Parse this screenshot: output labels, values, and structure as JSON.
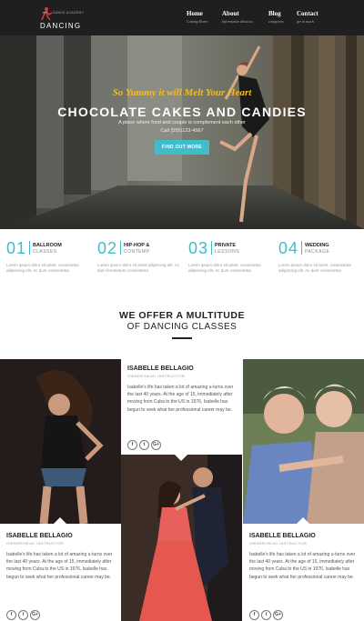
{
  "brand": {
    "name": "DANCING",
    "tagline": "DANCE ACADEMY"
  },
  "nav": [
    {
      "title": "Home",
      "sub": "Coming Home"
    },
    {
      "title": "About",
      "sub": "Information about us"
    },
    {
      "title": "Blog",
      "sub": "categories"
    },
    {
      "title": "Contact",
      "sub": "get in touch"
    }
  ],
  "hero": {
    "script": "So Yummy it will Melt Your Heart",
    "title": "CHOCOLATE CAKES AND CANDIES",
    "subtitle": "A place where food and couple is complement each other",
    "call": "Call (555)123-4567",
    "button": "FIND OUT MORE"
  },
  "features": [
    {
      "num": "01",
      "title": "BALLROOM",
      "sub": "CLASSES",
      "desc": "Lorem ipsum dolor sit amet, consectetur adipiscing elit. Ac dum consectetur."
    },
    {
      "num": "02",
      "title": "HIP-HOP &",
      "sub": "CONTEMP",
      "desc": "Lorem ipsum dolor sit amet adipiscing elit. Ac dum fermentum consectetur."
    },
    {
      "num": "03",
      "title": "PRIVATE",
      "sub": "LESSONS",
      "desc": "Lorem ipsum dolor sit amet, consectetur adipiscing elit. Ac dum consectetur."
    },
    {
      "num": "04",
      "title": "WEDDING",
      "sub": "PACKAGE",
      "desc": "Lorem ipsum dolor sit amet, consectetur adipiscing elit. Ac dum consectetur."
    }
  ],
  "offer": {
    "line1": "WE OFFER A MULTITUDE",
    "line2": "OF DANCING CLASSES"
  },
  "instructors": [
    {
      "name": "ISABELLE BELLAGIO",
      "role": "OWNER/HEAD INSTRUCTOR",
      "bio": "Isabelle's life has taken a lot of amazing u-turns over the last 40 years. At the age of 15, immediately after moving from Cuba to the US in 1976, Isabelle has begun to seek what her professional career may be."
    },
    {
      "name": "ISABELLE BELLAGIO",
      "role": "OWNER/HEAD INSTRUCTOR",
      "bio": "Isabelle's life has taken a lot of amazing u-turns over the last 40 years. At the age of 15, immediately after moving from Cuba to the US in 1976, Isabelle has begun to seek what her professional career may be."
    },
    {
      "name": "ISABELLE BELLAGIO",
      "role": "OWNER/HEAD INSTRUCTOR",
      "bio": "Isabelle's life has taken a lot of amazing u-turns over the last 40 years. At the age of 15, immediately after moving from Cuba to the US in 1976, Isabelle has begun to seek what her professional career may be."
    }
  ],
  "social": {
    "facebook": "f",
    "twitter": "t",
    "google": "G+"
  },
  "colors": {
    "accent": "#3fbec9",
    "script": "#f0bc2b",
    "nav_bg": "#1f1f1f"
  }
}
